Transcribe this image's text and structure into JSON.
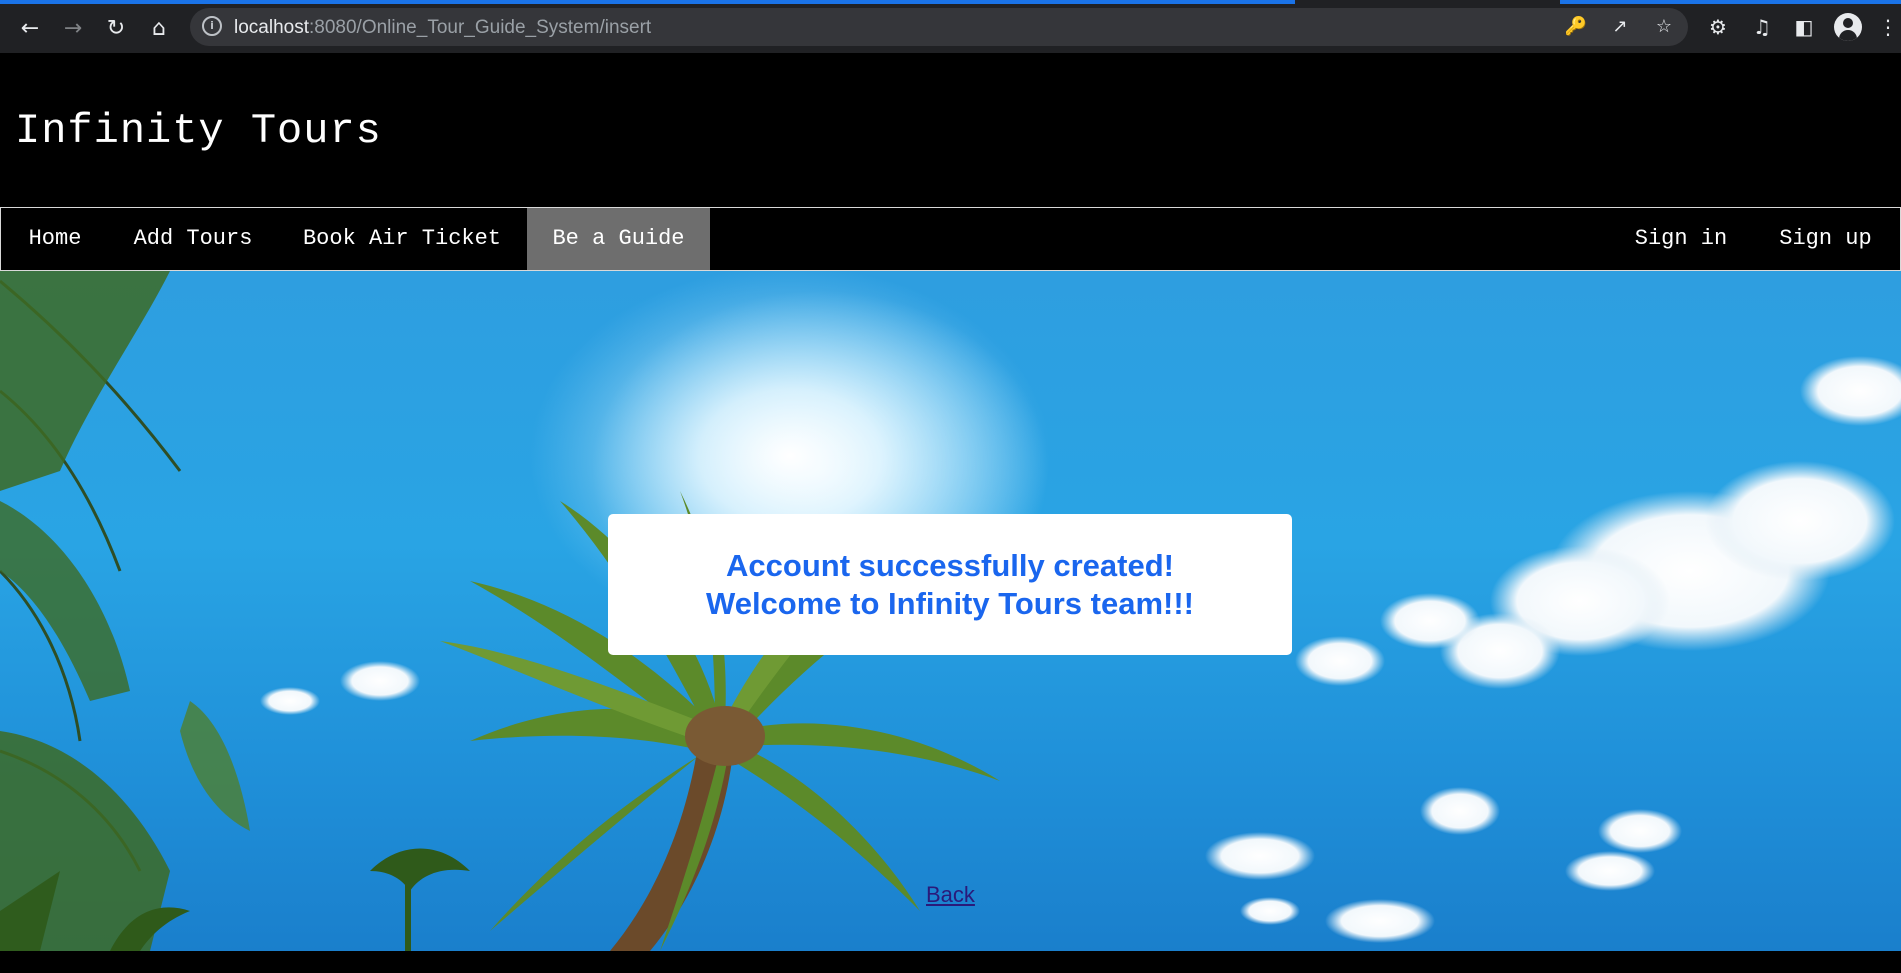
{
  "browser": {
    "url_host": "localhost",
    "url_rest": ":8080/Online_Tour_Guide_System/insert",
    "back_icon": "arrow-left-icon",
    "forward_icon": "arrow-right-icon",
    "reload_icon": "reload-icon",
    "home_icon": "home-icon",
    "site_info_icon": "info-icon",
    "key_icon": "key-icon",
    "share_icon": "share-icon",
    "bookmark_icon": "star-icon",
    "extensions_icon": "puzzle-icon",
    "media_icon": "playlist-icon",
    "sidepanel_icon": "side-panel-icon",
    "profile_icon": "profile-avatar-icon",
    "menu_icon": "kebab-menu-icon"
  },
  "site": {
    "title": "Infinity Tours"
  },
  "nav": {
    "left": [
      "Home",
      "Add Tours",
      "Book Air Ticket",
      "Be a Guide"
    ],
    "right": [
      "Sign in",
      "Sign up"
    ],
    "active": "Be a Guide"
  },
  "message": {
    "line1": "Account successfully created!",
    "line2": "Welcome to Infinity Tours team!!!"
  },
  "back_link": "Back",
  "colors": {
    "message_text": "#1a66ee",
    "nav_active_bg": "#6e6e6e",
    "link": "#2a1a7a"
  }
}
